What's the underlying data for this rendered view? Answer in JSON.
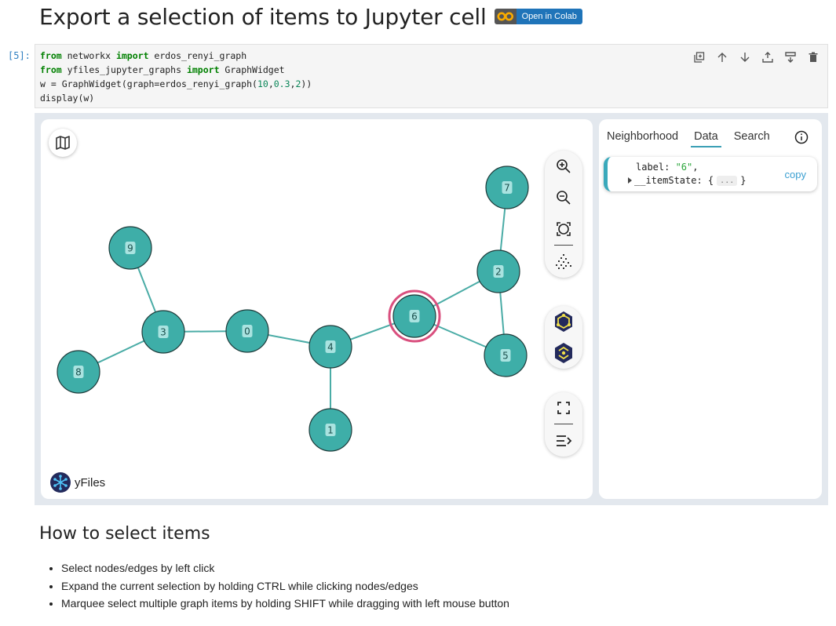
{
  "heading": {
    "title": "Export a selection of items to Jupyter cell",
    "badge": {
      "logo": "CO",
      "label": "Open in Colab"
    }
  },
  "cell": {
    "prompt": "[5]:",
    "code": {
      "l1": {
        "kw1": "from",
        "mod": " networkx ",
        "kw2": "import",
        "rest": " erdos_renyi_graph"
      },
      "l2": {
        "kw1": "from",
        "mod": " yfiles_jupyter_graphs ",
        "kw2": "import",
        "rest": " GraphWidget"
      },
      "l3": {
        "a": "w = GraphWidget(graph=erdos_renyi_graph(",
        "n1": "10",
        "c1": ",",
        "n2": "0.3",
        "c2": ",",
        "n3": "2",
        "b": "))"
      },
      "l4": "display(w)"
    },
    "toolbar": [
      "duplicate-icon",
      "move-up-icon",
      "move-down-icon",
      "insert-above-icon",
      "insert-below-icon",
      "delete-icon"
    ]
  },
  "graph": {
    "nodes": [
      {
        "id": "0",
        "label": "0",
        "selected": false
      },
      {
        "id": "1",
        "label": "1",
        "selected": false
      },
      {
        "id": "2",
        "label": "2",
        "selected": false
      },
      {
        "id": "3",
        "label": "3",
        "selected": false
      },
      {
        "id": "4",
        "label": "4",
        "selected": false
      },
      {
        "id": "5",
        "label": "5",
        "selected": false
      },
      {
        "id": "6",
        "label": "6",
        "selected": true
      },
      {
        "id": "7",
        "label": "7",
        "selected": false
      },
      {
        "id": "8",
        "label": "8",
        "selected": false
      },
      {
        "id": "9",
        "label": "9",
        "selected": false
      }
    ],
    "edges": [
      [
        "9",
        "3"
      ],
      [
        "3",
        "8"
      ],
      [
        "3",
        "0"
      ],
      [
        "0",
        "4"
      ],
      [
        "4",
        "1"
      ],
      [
        "4",
        "6"
      ],
      [
        "6",
        "2"
      ],
      [
        "6",
        "5"
      ],
      [
        "2",
        "5"
      ],
      [
        "2",
        "7"
      ]
    ],
    "colors": {
      "node": "#3eaea8",
      "node_stroke": "#1e3b3a",
      "edge": "#4aaca6",
      "label_bg": "#a9e3e0",
      "selection": "#d94f7e"
    },
    "toolbar": {
      "zoom": [
        "zoom-in-icon",
        "zoom-out-icon",
        "fit-content-icon"
      ],
      "layout": [
        "layout-icon"
      ],
      "brand_tools": [
        "yfiles-layout-icon",
        "yfiles-center-icon"
      ],
      "view": [
        "fullscreen-icon",
        "sidebar-toggle-icon"
      ]
    },
    "brand": "yFiles"
  },
  "sidebar": {
    "tabs": [
      {
        "label": "Neighborhood",
        "active": false
      },
      {
        "label": "Data",
        "active": true
      },
      {
        "label": "Search",
        "active": false
      }
    ],
    "data": {
      "key1": "label",
      "val1": "\"6\"",
      "key2": "__itemState",
      "collapsed": "...",
      "copy": "copy"
    }
  },
  "section": {
    "title": "How to select items",
    "bullets": [
      "Select nodes/edges by left click",
      "Expand the current selection by holding CTRL while clicking nodes/edges",
      "Marquee select multiple graph items by holding SHIFT while dragging with left mouse button"
    ]
  }
}
